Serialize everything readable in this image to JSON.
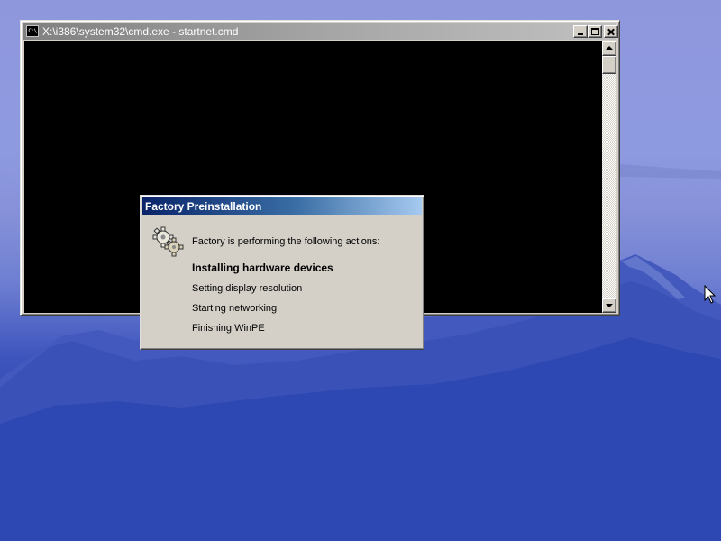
{
  "console_window": {
    "icon_text": "C:\\",
    "title": "X:\\i386\\system32\\cmd.exe - startnet.cmd",
    "buttons": [
      "minimize",
      "maximize",
      "close"
    ]
  },
  "factory_dialog": {
    "title": "Factory Preinstallation",
    "icon": "gears-icon",
    "message": "Factory is performing the following actions:",
    "actions": [
      {
        "label": "Installing hardware devices",
        "state": "current"
      },
      {
        "label": "Setting display resolution",
        "state": "pending"
      },
      {
        "label": "Starting networking",
        "state": "pending"
      },
      {
        "label": "Finishing WinPE",
        "state": "pending"
      }
    ]
  },
  "colors": {
    "console_background": "#000000",
    "active_titlebar": "#0a246a",
    "inactive_titlebar": "#808080",
    "window_face": "#d4d0c8",
    "desktop_sky": "#8e97dc",
    "desktop_mountain": "#2a44b0"
  }
}
